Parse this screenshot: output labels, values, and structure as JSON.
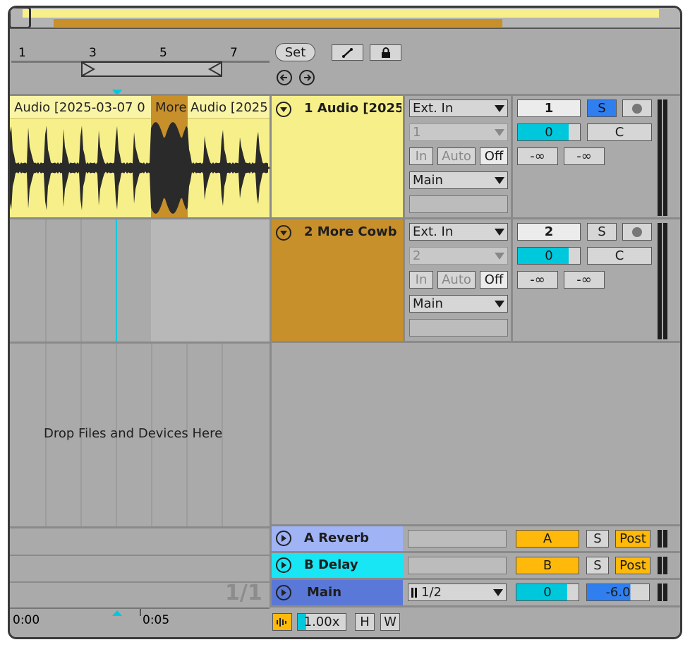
{
  "ruler": {
    "bars": [
      "1",
      "3",
      "5",
      "7"
    ],
    "time_marks": [
      "0:00",
      "0:05"
    ]
  },
  "controls": {
    "set_label": "Set"
  },
  "clips": {
    "clip1_a": "Audio [2025-03-07 0",
    "clip_more": "More",
    "clip1_b": "Audio [2025"
  },
  "tracks": [
    {
      "name": "1 Audio [2025",
      "input": "Ext. In",
      "channel": "1",
      "monitor": [
        "In",
        "Auto",
        "Off"
      ],
      "output": "Main",
      "number": "1",
      "solo": "S",
      "volume": "0",
      "pan": "C",
      "sends": [
        "-∞",
        "-∞"
      ],
      "color": "#f7f08a"
    },
    {
      "name": "2 More Cowb",
      "input": "Ext. In",
      "channel": "2",
      "monitor": [
        "In",
        "Auto",
        "Off"
      ],
      "output": "Main",
      "number": "2",
      "solo": "S",
      "volume": "0",
      "pan": "C",
      "sends": [
        "-∞",
        "-∞"
      ],
      "color": "#c8902a"
    }
  ],
  "drop_hint": "Drop Files and Devices Here",
  "returns": [
    {
      "name": "A Reverb",
      "letter": "A",
      "solo": "S",
      "post": "Post",
      "color": "#9fb3f5"
    },
    {
      "name": "B Delay",
      "letter": "B",
      "solo": "S",
      "post": "Post",
      "color": "#19e6f5"
    }
  ],
  "main": {
    "name": "Main",
    "fraction": "1/1",
    "cue": "1/2",
    "volume": "0",
    "db": "-6.0",
    "color": "#5a78d8"
  },
  "bottom": {
    "zoom": "1.00x",
    "h": "H",
    "w": "W"
  },
  "colors": {
    "accent_cyan": "#00c8dc",
    "solo_blue": "#2f7ff0",
    "return_orange": "#ffb90a"
  }
}
